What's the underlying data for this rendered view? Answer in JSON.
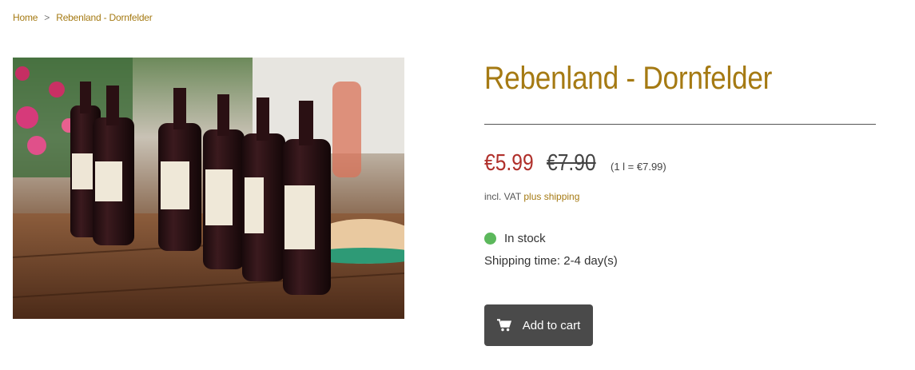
{
  "breadcrumb": {
    "items": [
      "Home",
      "Rebenland - Dornfelder"
    ],
    "separator": ">"
  },
  "product": {
    "title": "Rebenland - Dornfelder",
    "image_alt": "Wine bottles on a wooden table",
    "price_current": "€5.99",
    "price_old": "€7.90",
    "unit_price": "(1 l = €7.99)",
    "vat_text": "incl. VAT",
    "shipping_link": "plus shipping",
    "stock_status": "In stock",
    "shipping_time": "Shipping time: 2-4 day(s)",
    "add_to_cart_label": "Add to cart"
  },
  "icons": {
    "breadcrumb_separator": "chevron-right-icon",
    "stock_indicator": "status-dot-icon",
    "cart": "cart-icon"
  },
  "colors": {
    "accent": "#a57a13",
    "price_red": "#b0302b",
    "in_stock_green": "#5cb85c",
    "button_bg": "#4a4a4a"
  }
}
